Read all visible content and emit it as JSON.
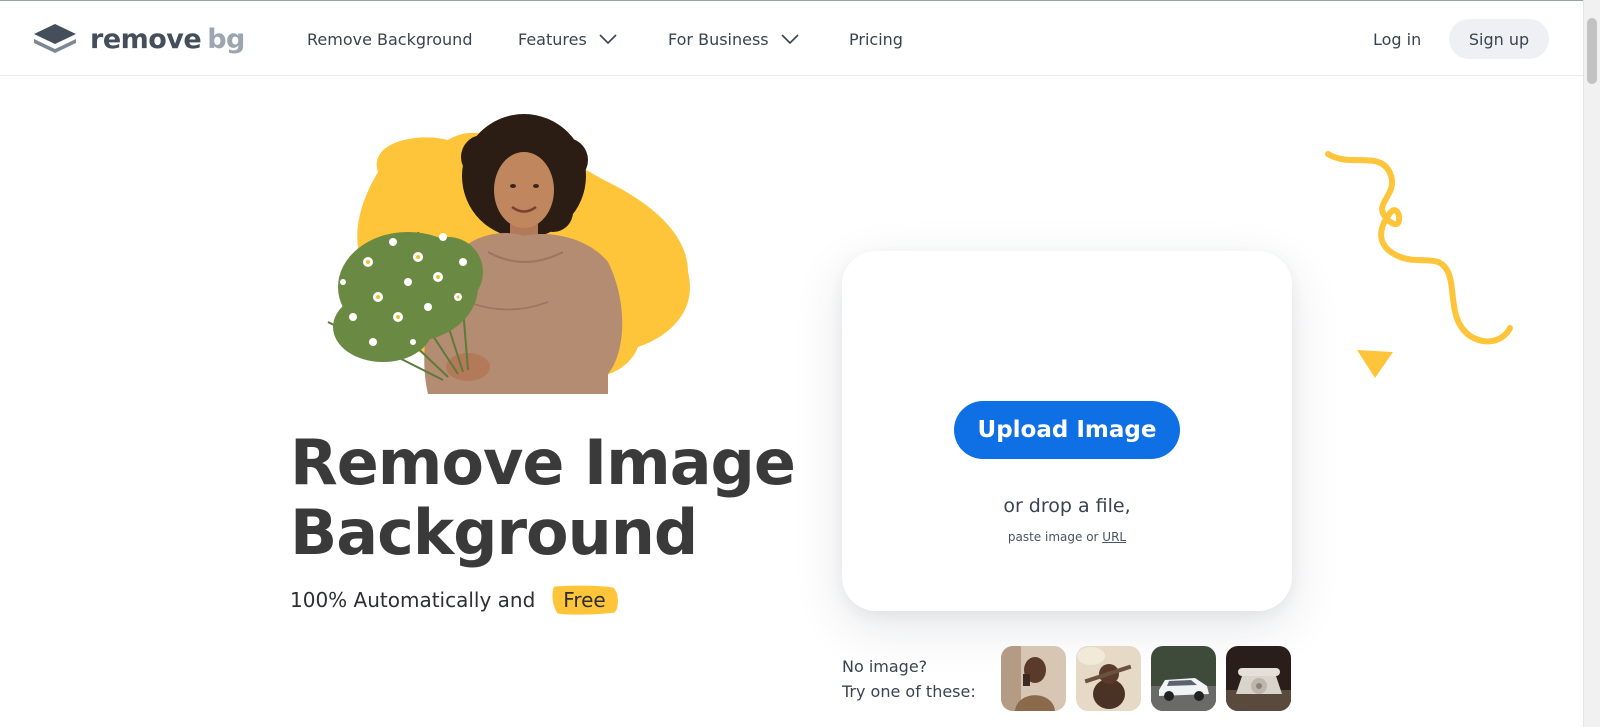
{
  "header": {
    "logo": {
      "word": "remove",
      "suffix": "bg"
    },
    "nav": [
      {
        "label": "Remove Background",
        "dropdown": false
      },
      {
        "label": "Features",
        "dropdown": true
      },
      {
        "label": "For Business",
        "dropdown": true
      },
      {
        "label": "Pricing",
        "dropdown": false
      }
    ],
    "login_label": "Log in",
    "signup_label": "Sign up"
  },
  "hero": {
    "title_line1": "Remove Image",
    "title_line2": "Background",
    "subtitle": "100% Automatically and",
    "free_badge": "Free"
  },
  "upload": {
    "button_label": "Upload Image",
    "drop_text": "or drop a file,",
    "paste_prefix": "paste image or",
    "paste_link": "URL"
  },
  "samples": {
    "line1": "No image?",
    "line2": "Try one of these:",
    "thumbnails": [
      "person-thumbnail",
      "dog-thumbnail",
      "car-thumbnail",
      "telephone-thumbnail"
    ]
  },
  "colors": {
    "accent_blue": "#0f70e6",
    "accent_yellow": "#fec53a",
    "title_text": "#3a3a3a"
  }
}
